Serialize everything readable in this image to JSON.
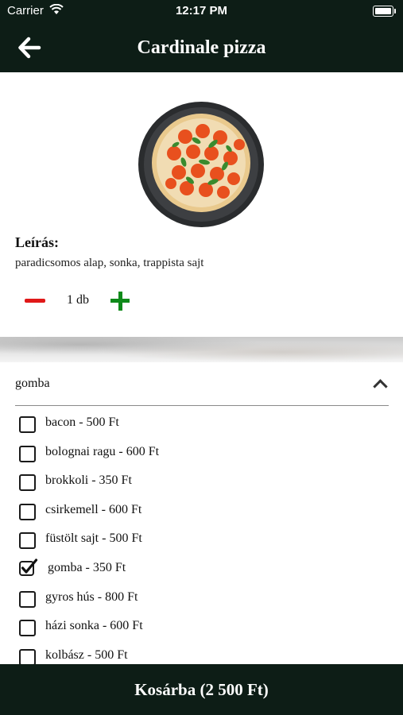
{
  "status_bar": {
    "carrier": "Carrier",
    "time": "12:17 PM"
  },
  "header": {
    "title": "Cardinale pizza",
    "back_icon": "arrow-left-icon"
  },
  "product": {
    "image_icon": "pizza-image",
    "description_label": "Leírás:",
    "description": "paradicsomos alap, sonka, trappista sajt",
    "quantity_text": "1 db",
    "quantity": 1
  },
  "extras": {
    "selected": "gomba",
    "options": [
      {
        "label": "bacon - 500 Ft",
        "checked": false
      },
      {
        "label": "bolognai ragu - 600 Ft",
        "checked": false
      },
      {
        "label": "brokkoli - 350 Ft",
        "checked": false
      },
      {
        "label": "csirkemell - 600 Ft",
        "checked": false
      },
      {
        "label": "füstölt sajt - 500 Ft",
        "checked": false
      },
      {
        "label": "gomba - 350 Ft",
        "checked": true
      },
      {
        "label": "gyros hús - 800 Ft",
        "checked": false
      },
      {
        "label": "házi sonka - 600 Ft",
        "checked": false
      },
      {
        "label": "kolbász - 500 Ft",
        "checked": false
      }
    ]
  },
  "cart": {
    "button_label": "Kosárba (2 500 Ft)"
  },
  "colors": {
    "dark_bar": "#0d1d16",
    "minus": "#e01818",
    "plus": "#0f8a1a"
  }
}
